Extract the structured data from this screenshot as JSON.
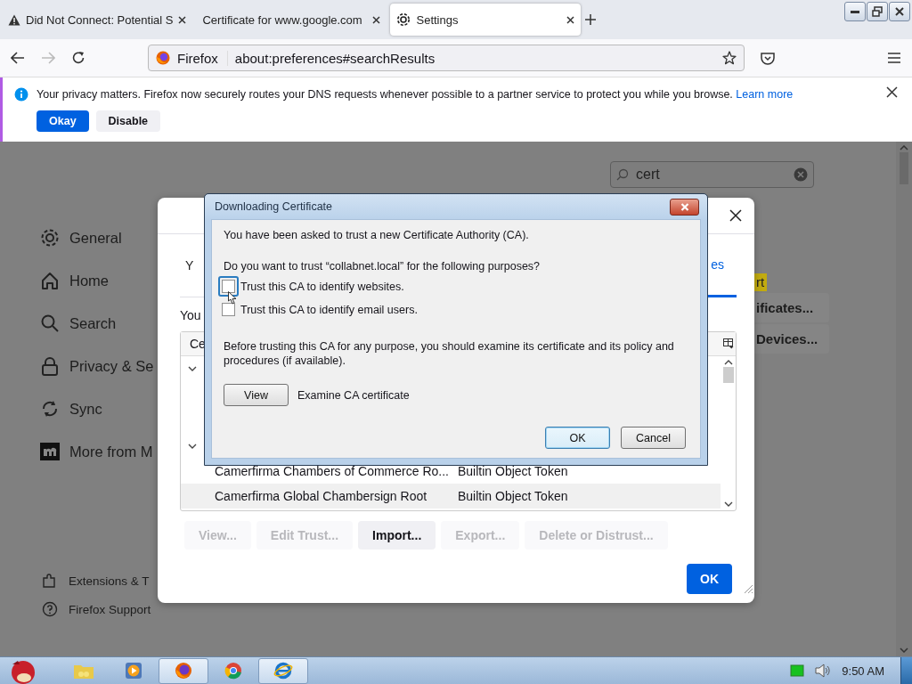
{
  "browser": {
    "tabs": [
      {
        "title": "Did Not Connect: Potential S",
        "selected": false
      },
      {
        "title": "Certificate for www.google.com",
        "selected": false
      },
      {
        "title": "Settings",
        "selected": true
      }
    ],
    "identity_label": "Firefox",
    "url": "about:preferences#searchResults"
  },
  "notification": {
    "message": "Your privacy matters. Firefox now securely routes your DNS requests whenever possible to a partner service to protect you while you browse.",
    "link": "Learn more",
    "buttons": [
      {
        "label": "Okay",
        "primary": true
      },
      {
        "label": "Disable",
        "primary": false
      }
    ]
  },
  "settings": {
    "search_value": "cert",
    "sidebar": [
      {
        "label": "General"
      },
      {
        "label": "Home"
      },
      {
        "label": "Search"
      },
      {
        "label": "Privacy & Se"
      },
      {
        "label": "Sync"
      },
      {
        "label": "More from M"
      }
    ],
    "footer": [
      {
        "label": "Extensions & T"
      },
      {
        "label": "Firefox Support"
      }
    ],
    "highlight": "rt",
    "buttons": [
      "ificates...",
      "Devices..."
    ]
  },
  "certificate_manager": {
    "tab_fragment": "Y",
    "selected_tab_fragment": "es",
    "intro": "You",
    "column_1": "Ce",
    "rows": [
      {
        "name": "Camerfirma Chambers of Commerce Ro...",
        "token": "Builtin Object Token"
      },
      {
        "name": "Camerfirma Global Chambersign Root",
        "token": "Builtin Object Token"
      }
    ],
    "buttons": [
      {
        "label": "View...",
        "disabled": true
      },
      {
        "label": "Edit Trust...",
        "disabled": true
      },
      {
        "label": "Import...",
        "disabled": false
      },
      {
        "label": "Export...",
        "disabled": true
      },
      {
        "label": "Delete or Distrust...",
        "disabled": true
      }
    ],
    "ok": "OK"
  },
  "download_dialog": {
    "title": "Downloading Certificate",
    "intro": "You have been asked to trust a new Certificate Authority (CA).",
    "question": "Do you want to trust “collabnet.local” for the following purposes?",
    "options": [
      {
        "label": "Trust this CA to identify websites.",
        "checked": false,
        "focused": true
      },
      {
        "label": "Trust this CA to identify email users.",
        "checked": false,
        "focused": false
      }
    ],
    "advice": "Before trusting this CA for any purpose, you should examine its certificate and its policy and procedures (if available).",
    "view_button": "View",
    "view_caption": "Examine CA certificate",
    "ok": "OK",
    "cancel": "Cancel"
  },
  "taskbar": {
    "apps": [
      {
        "active": false
      },
      {
        "active": false
      },
      {
        "active": true
      },
      {
        "active": false
      },
      {
        "active": true
      }
    ],
    "clock": "9:50 AM"
  }
}
